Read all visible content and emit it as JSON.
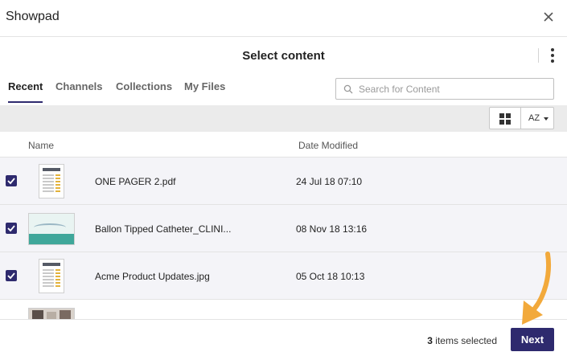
{
  "window": {
    "title": "Showpad"
  },
  "header": {
    "title": "Select content"
  },
  "tabs": [
    {
      "label": "Recent",
      "active": true
    },
    {
      "label": "Channels",
      "active": false
    },
    {
      "label": "Collections",
      "active": false
    },
    {
      "label": "My Files",
      "active": false
    }
  ],
  "search": {
    "placeholder": "Search for Content",
    "value": ""
  },
  "toolbar": {
    "view_icon": "grid-icon",
    "sort_label": "AZ"
  },
  "columns": {
    "name": "Name",
    "date": "Date Modified"
  },
  "files": [
    {
      "name": "ONE PAGER 2.pdf",
      "date": "24 Jul 18 07:10",
      "checked": true,
      "thumb": "document"
    },
    {
      "name": "Ballon Tipped Catheter_CLINI...",
      "date": "08 Nov 18 13:16",
      "checked": true,
      "thumb": "slide"
    },
    {
      "name": "Acme Product Updates.jpg",
      "date": "05 Oct 18 10:13",
      "checked": true,
      "thumb": "document"
    },
    {
      "name": "",
      "date": "",
      "checked": false,
      "thumb": "photo"
    }
  ],
  "footer": {
    "selected_count": "3",
    "selected_suffix": "items selected",
    "next_label": "Next"
  },
  "colors": {
    "accent": "#2e2a6e",
    "arrow": "#f2a93b",
    "toolbar_bg": "#ebebeb",
    "row_bg": "#f4f4f8"
  }
}
